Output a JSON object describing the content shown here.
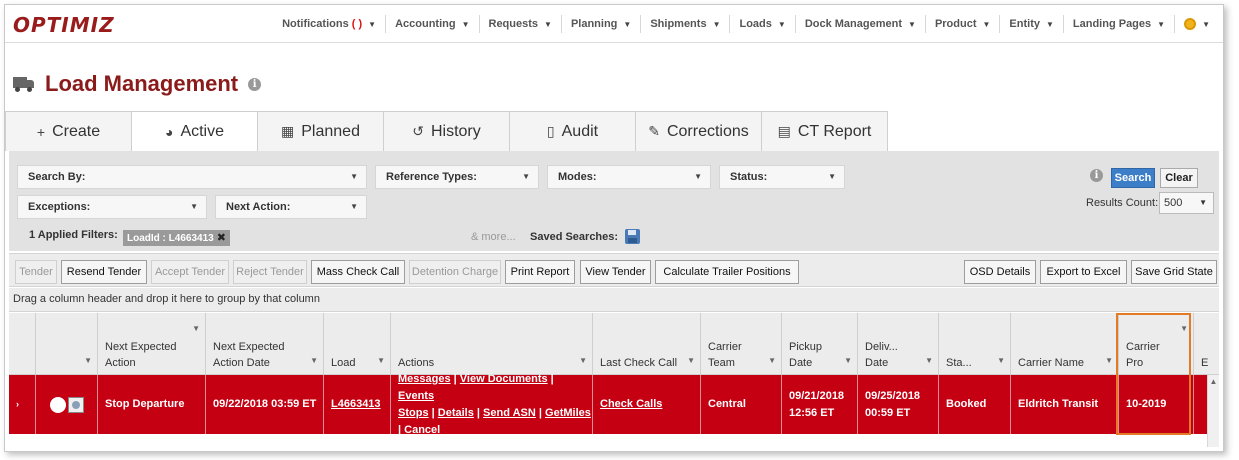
{
  "app": {
    "logo": "OPTIMIZ",
    "nav": [
      {
        "label": "Notifications",
        "badge": "( )"
      },
      {
        "label": "Accounting"
      },
      {
        "label": "Requests"
      },
      {
        "label": "Planning"
      },
      {
        "label": "Shipments"
      },
      {
        "label": "Loads"
      },
      {
        "label": "Dock Management"
      },
      {
        "label": "Product"
      },
      {
        "label": "Entity"
      },
      {
        "label": "Landing Pages"
      }
    ],
    "nav_caret": "▼"
  },
  "page": {
    "title": "Load Management",
    "info_glyph": "i"
  },
  "tabs": [
    {
      "label": "Create",
      "icon": "plus-icon",
      "glyph": "+"
    },
    {
      "label": "Active",
      "icon": "active-icon",
      "glyph": "◕"
    },
    {
      "label": "Planned",
      "icon": "calendar-icon",
      "glyph": "▦"
    },
    {
      "label": "History",
      "icon": "history-icon",
      "glyph": "↺"
    },
    {
      "label": "Audit",
      "icon": "clipboard-icon",
      "glyph": "▯"
    },
    {
      "label": "Corrections",
      "icon": "pencil-icon",
      "glyph": "✎"
    },
    {
      "label": "CT Report",
      "icon": "report-icon",
      "glyph": "▤"
    }
  ],
  "filters": {
    "search_by": "Search By:",
    "reference_types": "Reference Types:",
    "modes": "Modes:",
    "status": "Status:",
    "exceptions": "Exceptions:",
    "next_action": "Next Action:",
    "applied_label": "1 Applied Filters:",
    "chip": "LoadId : L4663413",
    "chip_close": "✖",
    "more": "& more...",
    "saved_searches": "Saved Searches:",
    "search_btn": "Search",
    "clear_btn": "Clear",
    "results_count_label": "Results Count:",
    "results_count_value": "500"
  },
  "toolbar": {
    "tender": "Tender",
    "resend_tender": "Resend Tender",
    "accept_tender": "Accept Tender",
    "reject_tender": "Reject Tender",
    "mass_check_call": "Mass Check Call",
    "detention_charge": "Detention Charge",
    "print_report": "Print Report",
    "view_tender": "View Tender",
    "calc_trailer": "Calculate Trailer Positions",
    "osd_details": "OSD Details",
    "export_excel": "Export to Excel",
    "save_grid": "Save Grid State"
  },
  "grid": {
    "group_hint": "Drag a column header and drop it here to group by that column",
    "headers": {
      "next_action": "Next Expected Action",
      "next_action_date": "Next Expected Action Date",
      "load": "Load",
      "actions": "Actions",
      "last_check_call": "Last Check Call",
      "carrier_team": "Carrier Team",
      "pickup_date": "Pickup Date",
      "delivery_date": "Deliv... Date",
      "status": "Sta...",
      "carrier_name": "Carrier Name",
      "carrier_pro": "Carrier Pro",
      "overflow": "E"
    },
    "row": {
      "next_action": "Stop Departure",
      "next_action_date": "09/22/2018 03:59 ET",
      "load": "L4663413",
      "actions_line1": [
        "Messages",
        "View Documents",
        "Events"
      ],
      "actions_line2": [
        "Stops",
        "Details",
        "Send ASN",
        "GetMiles"
      ],
      "actions_line3": [
        "Cancel"
      ],
      "last_check_call": "Check Calls",
      "carrier_team": "Central",
      "pickup_date_1": "09/21/2018",
      "pickup_date_2": "12:56 ET",
      "delivery_date_1": "09/25/2018",
      "delivery_date_2": "00:59 ET",
      "status": "Booked",
      "carrier_name": "Eldritch Transit",
      "carrier_pro": "10-2019"
    }
  },
  "colors": {
    "brand": "#8b1a1a",
    "row_highlight": "#c40012",
    "callout": "#e37a25",
    "search_button": "#3d7ec8"
  }
}
